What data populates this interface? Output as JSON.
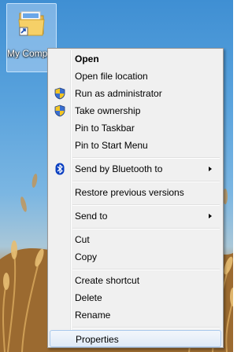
{
  "desktop": {
    "shortcut_label": "My Computer"
  },
  "context_menu": {
    "items": [
      {
        "label": "Open",
        "bold": true,
        "icon": null,
        "submenu": false
      },
      {
        "label": "Open file location",
        "icon": null,
        "submenu": false
      },
      {
        "label": "Run as administrator",
        "icon": "uac-shield-icon",
        "submenu": false
      },
      {
        "label": "Take ownership",
        "icon": "uac-shield-icon",
        "submenu": false
      },
      {
        "label": "Pin to Taskbar",
        "icon": null,
        "submenu": false
      },
      {
        "label": "Pin to Start Menu",
        "icon": null,
        "submenu": false
      },
      {
        "label": "Send by Bluetooth to",
        "icon": "bluetooth-icon",
        "submenu": true
      },
      {
        "label": "Restore previous versions",
        "icon": null,
        "submenu": false
      },
      {
        "label": "Send to",
        "icon": null,
        "submenu": true
      },
      {
        "label": "Cut",
        "icon": null,
        "submenu": false
      },
      {
        "label": "Copy",
        "icon": null,
        "submenu": false
      },
      {
        "label": "Create shortcut",
        "icon": null,
        "submenu": false
      },
      {
        "label": "Delete",
        "icon": null,
        "submenu": false
      },
      {
        "label": "Rename",
        "icon": null,
        "submenu": false
      },
      {
        "label": "Properties",
        "icon": null,
        "submenu": false,
        "highlighted": true
      }
    ]
  },
  "colors": {
    "menu_background": "#f0f0f0",
    "highlight_border": "#a8c8ec",
    "bluetooth": "#0a3fc1",
    "shield_blue": "#3a6fd0",
    "shield_yellow": "#f3c522"
  }
}
